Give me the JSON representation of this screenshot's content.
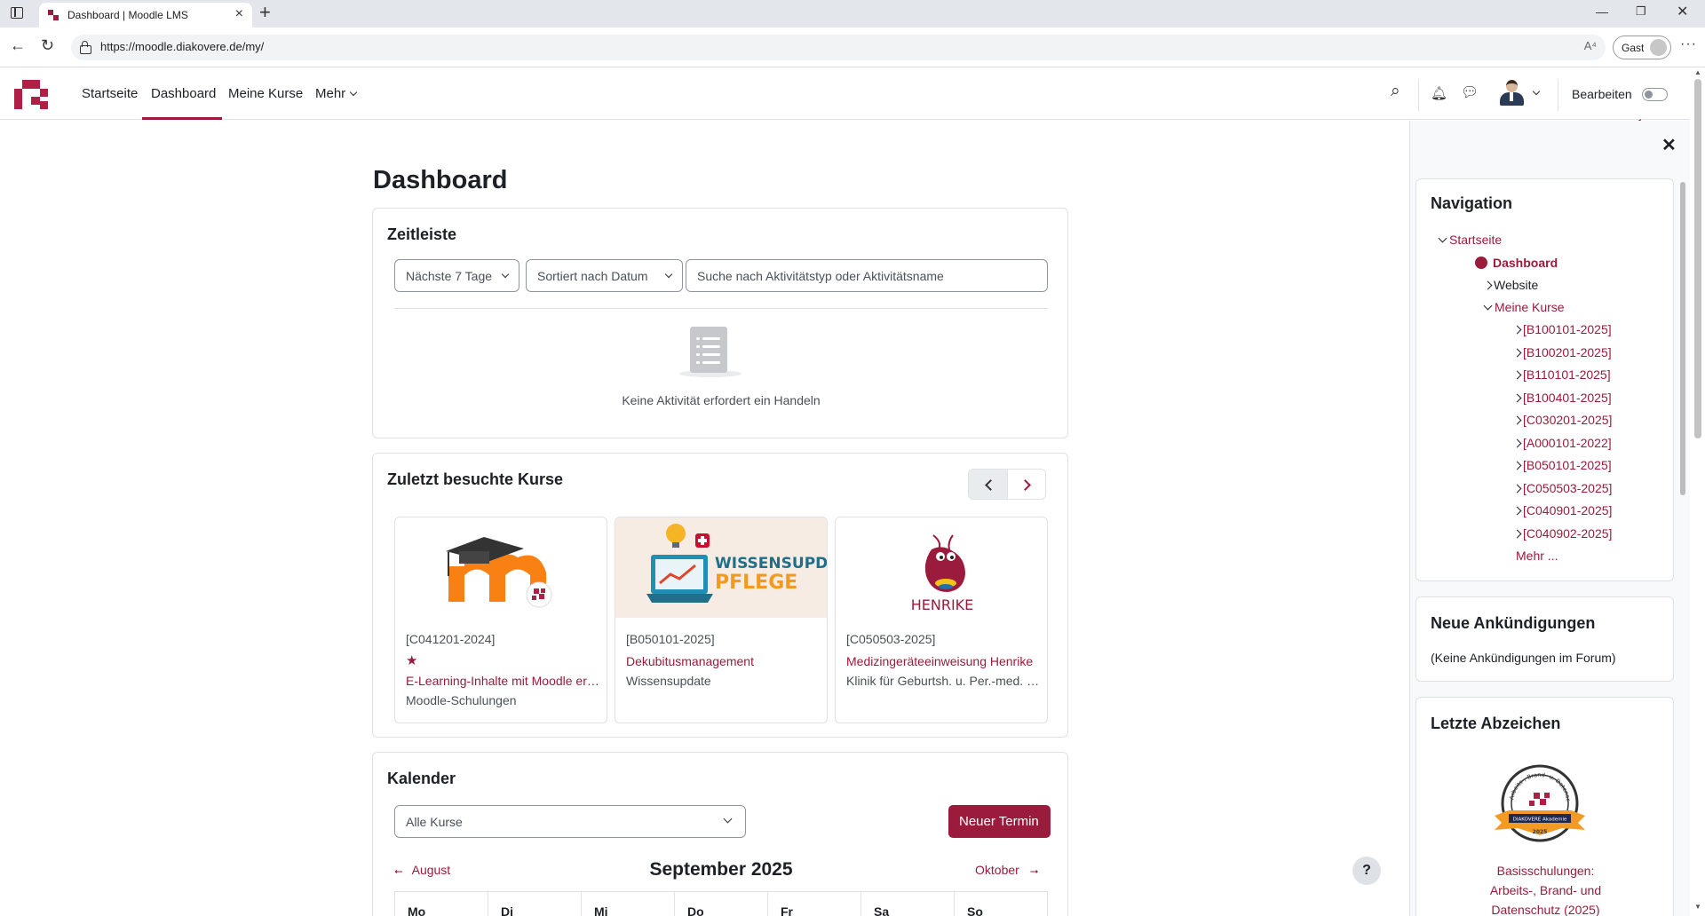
{
  "browser": {
    "tab_title": "Dashboard | Moodle LMS",
    "url": "https://moodle.diakovere.de/my/",
    "guest_label": "Gast",
    "read_aloud": "A⁴"
  },
  "navbar": {
    "links": [
      "Startseite",
      "Dashboard",
      "Meine Kurse",
      "Mehr"
    ],
    "edit_label": "Bearbeiten",
    "accent": "#9a1b3c"
  },
  "page": {
    "title": "Dashboard"
  },
  "timeline": {
    "title": "Zeitleiste",
    "filter_days": "Nächste 7 Tage",
    "sort": "Sortiert nach Datum",
    "search_placeholder": "Suche nach Aktivitätstyp oder Aktivitätsname",
    "empty_text": "Keine Aktivität erfordert ein Handeln"
  },
  "recent_courses": {
    "title": "Zuletzt besuchte Kurse",
    "courses": [
      {
        "code": "[C041201-2024]",
        "starred": true,
        "name": "E-Learning-Inhalte mit Moodle erstellen",
        "category": "Moodle-Schulungen"
      },
      {
        "code": "[B050101-2025]",
        "starred": false,
        "name": "Dekubitusmanagement",
        "category": "Wissensupdate",
        "image_text_1": "WISSENSUPDATE",
        "image_text_2": "PFLEGE"
      },
      {
        "code": "[C050503-2025]",
        "starred": false,
        "name": "Medizingeräteeinweisung Henrike",
        "category": "Klinik für Geburtsh. u. Per.-med. (Henrike)",
        "image_text_1": "HENRIKE"
      }
    ]
  },
  "calendar": {
    "title": "Kalender",
    "course_filter": "Alle Kurse",
    "new_event": "Neuer Termin",
    "prev_month": "August",
    "current_month": "September 2025",
    "next_month": "Oktober",
    "day_headers": [
      "Mo",
      "Di",
      "Mi",
      "Do",
      "Fr",
      "Sa",
      "So"
    ]
  },
  "help_label": "?",
  "drawer": {
    "navigation": {
      "title": "Navigation",
      "home": "Startseite",
      "dashboard": "Dashboard",
      "website": "Website",
      "my_courses": "Meine Kurse",
      "courses": [
        "[B100101-2025]",
        "[B100201-2025]",
        "[B110101-2025]",
        "[B100401-2025]",
        "[C030201-2025]",
        "[A000101-2022]",
        "[B050101-2025]",
        "[C050503-2025]",
        "[C040901-2025]",
        "[C040902-2025]"
      ],
      "more": "Mehr ..."
    },
    "announcements": {
      "title": "Neue Ankündigungen",
      "text": "(Keine Ankündigungen im Forum)"
    },
    "badges": {
      "title": "Letzte Abzeichen",
      "badge_ring_text": "Arbeits-, Brand- u. Datenschutz",
      "badge_ribbon": "DIAKOVERE Akademie",
      "badge_year": "2025",
      "caption_lines": [
        "Basisschulungen:",
        "Arbeits-, Brand- und",
        "Datenschutz (2025)"
      ]
    }
  }
}
